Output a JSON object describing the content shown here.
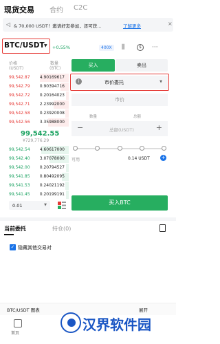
{
  "tabs": [
    {
      "label": "现货交易",
      "active": true
    },
    {
      "label": "合约",
      "active": false
    },
    {
      "label": "C2C",
      "active": false
    }
  ],
  "banner": {
    "speaker_icon": "speaker-icon",
    "text": "& 70,000 USDT！邀请好友参加，还可获...",
    "link": "了解更多",
    "close": "×"
  },
  "pair": {
    "symbol": "BTC/USDT",
    "change": "+0.55%",
    "leverage": "400X",
    "icons": [
      "candlestick-icon",
      "dollar-icon",
      "more-icon"
    ]
  },
  "orderbook": {
    "price_header": "价格",
    "price_unit": "(USDT)",
    "qty_header": "数量",
    "qty_unit": "(BTC)",
    "asks": [
      {
        "price": "99,542.87",
        "qty": "4.90169617"
      },
      {
        "price": "99,542.79",
        "qty": "0.90394716"
      },
      {
        "price": "99,542.72",
        "qty": "0.20164023"
      },
      {
        "price": "99,542.71",
        "qty": "2.23992000"
      },
      {
        "price": "99,542.58",
        "qty": "0.23920008"
      },
      {
        "price": "99,542.56",
        "qty": "3.35988000"
      }
    ],
    "last_price": "99,542.55",
    "last_fiat": "¥729,776.29",
    "bids": [
      {
        "price": "99,542.54",
        "qty": "4.60617000"
      },
      {
        "price": "99,542.40",
        "qty": "3.07078000"
      },
      {
        "price": "99,542.00",
        "qty": "0.20794527"
      },
      {
        "price": "99,541.85",
        "qty": "0.80492095"
      },
      {
        "price": "99,541.53",
        "qty": "0.24021192"
      },
      {
        "price": "99,541.45",
        "qty": "0.20199191"
      }
    ],
    "precision": "0.01"
  },
  "trade": {
    "buy_tab": "买入",
    "sell_tab": "卖出",
    "order_type": "市价委托",
    "market_field": "市价",
    "qty_label": "数量",
    "total_label": "总额",
    "amount_placeholder": "总额(USDT)",
    "minus": "−",
    "plus": "+",
    "avail_label": "可用",
    "avail_value": "0.14 USDT",
    "buy_button": "买入BTC"
  },
  "orders": {
    "tab_current": "当前委托",
    "tab_holdings": "持仓(0)",
    "hide_others": "隐藏其他交易对",
    "hide_checked": true
  },
  "bottom": {
    "chart_label": "BTC/USDT 图表",
    "right_label": "展开",
    "home_label": "首页"
  },
  "watermark": {
    "text": "汉界软件园"
  }
}
